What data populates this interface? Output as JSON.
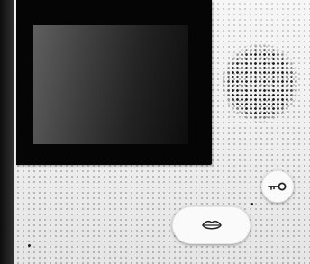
{
  "device": {
    "type": "video intercom monitor",
    "screen_state": "off",
    "colors": {
      "body": "#f1f1f1",
      "bezel": "#050505",
      "dots": "#828282",
      "icon": "#222222"
    }
  },
  "buttons": [
    {
      "id": "key",
      "icon": "key-icon"
    },
    {
      "id": "talk",
      "icon": "lips-icon"
    }
  ]
}
